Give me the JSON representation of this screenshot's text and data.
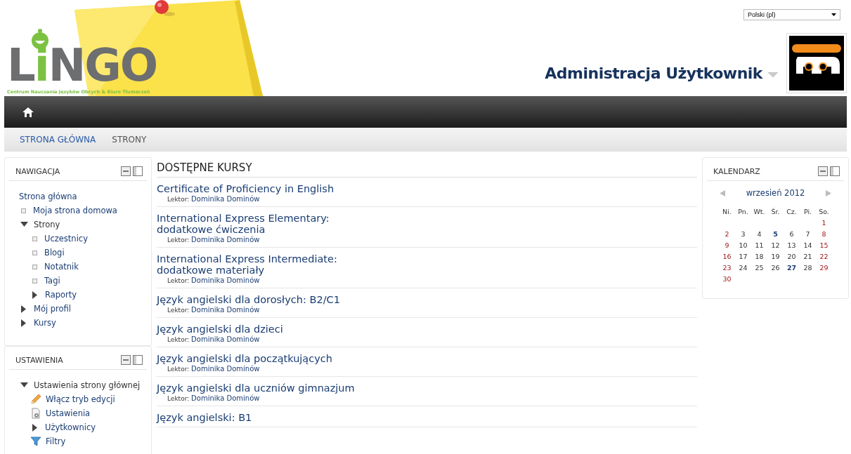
{
  "header": {
    "logo": {
      "name_start": "L",
      "name_face": "i",
      "name_end": "NGO",
      "tagline": "Centrum Nauczania Języków Obcych & Biuro Tłumaczeń"
    },
    "language": "Polski (pl)",
    "user_name": "Administracja Użytkownik"
  },
  "breadcrumb": [
    {
      "label": "STRONA GŁÓWNA",
      "link": true
    },
    {
      "label": "STRONY",
      "link": false
    }
  ],
  "navigation": {
    "title": "NAWIGACJA",
    "items": [
      {
        "label": "Strona główna",
        "kind": "home"
      },
      {
        "label": "Moja strona domowa",
        "kind": "leaf"
      },
      {
        "label": "Strony",
        "kind": "branch",
        "expanded": true,
        "children": [
          {
            "label": "Uczestnicy",
            "kind": "leaf"
          },
          {
            "label": "Blogi",
            "kind": "leaf"
          },
          {
            "label": "Notatnik",
            "kind": "leaf"
          },
          {
            "label": "Tagi",
            "kind": "leaf"
          },
          {
            "label": "Raporty",
            "kind": "branch",
            "expanded": false
          }
        ]
      },
      {
        "label": "Mój profil",
        "kind": "branch",
        "expanded": false
      },
      {
        "label": "Kursy",
        "kind": "branch",
        "expanded": false
      }
    ]
  },
  "settings": {
    "title": "USTAWIENIA",
    "items": [
      {
        "label": "Ustawienia strony głównej",
        "kind": "branch",
        "expanded": true,
        "children": [
          {
            "label": "Włącz tryb edycji",
            "kind": "edit"
          },
          {
            "label": "Ustawienia",
            "kind": "page"
          },
          {
            "label": "Użytkownicy",
            "kind": "branch",
            "expanded": false
          },
          {
            "label": "Filtry",
            "kind": "filter"
          }
        ]
      }
    ]
  },
  "courses": {
    "title": "DOSTĘPNE KURSY",
    "items": [
      {
        "title": "Certificate of Proficiency in English",
        "label": "Lektor:",
        "teacher": "Dominika Dominów"
      },
      {
        "title": "International Express Elementary:\ndodatkowe ćwiczenia",
        "label": "Lektor:",
        "teacher": "Dominika Dominów"
      },
      {
        "title": "International Express Intermediate:\ndodatkowe materiały",
        "label": "Lektor:",
        "teacher": "Dominika Dominów"
      },
      {
        "title": "Język angielski dla dorosłych: B2/C1",
        "label": "Lektor:",
        "teacher": "Dominika Dominów"
      },
      {
        "title": "Język angielski dla dzieci",
        "label": "Lektor:",
        "teacher": "Dominika Dominów"
      },
      {
        "title": "Język angielski dla początkujących",
        "label": "Lektor:",
        "teacher": "Dominika Dominów"
      },
      {
        "title": "Język angielski dla uczniów gimnazjum",
        "label": "Lektor:",
        "teacher": "Dominika Dominów"
      },
      {
        "title": "Język angielski: B1"
      }
    ]
  },
  "calendar": {
    "title": "KALENDARZ",
    "month": "wrzesień 2012",
    "weekdays": [
      "Ni.",
      "Pn.",
      "Wt.",
      "Śr.",
      "Cz.",
      "Pi.",
      "So."
    ],
    "weeks": [
      [
        {
          "kind": "empty"
        },
        {
          "kind": "empty"
        },
        {
          "kind": "empty"
        },
        {
          "kind": "empty"
        },
        {
          "kind": "empty"
        },
        {
          "kind": "empty"
        },
        {
          "day": "1",
          "kind": "weekend"
        }
      ],
      [
        {
          "day": "2",
          "kind": "weekend"
        },
        {
          "day": "3",
          "kind": "day"
        },
        {
          "day": "4",
          "kind": "day"
        },
        {
          "day": "5",
          "kind": "event"
        },
        {
          "day": "6",
          "kind": "day"
        },
        {
          "day": "7",
          "kind": "day"
        },
        {
          "day": "8",
          "kind": "weekend"
        }
      ],
      [
        {
          "day": "9",
          "kind": "weekend"
        },
        {
          "day": "10",
          "kind": "day"
        },
        {
          "day": "11",
          "kind": "day"
        },
        {
          "day": "12",
          "kind": "day"
        },
        {
          "day": "13",
          "kind": "day"
        },
        {
          "day": "14",
          "kind": "day"
        },
        {
          "day": "15",
          "kind": "weekend"
        }
      ],
      [
        {
          "day": "16",
          "kind": "weekend"
        },
        {
          "day": "17",
          "kind": "day"
        },
        {
          "day": "18",
          "kind": "day"
        },
        {
          "day": "19",
          "kind": "day"
        },
        {
          "day": "20",
          "kind": "day"
        },
        {
          "day": "21",
          "kind": "day"
        },
        {
          "day": "22",
          "kind": "weekend"
        }
      ],
      [
        {
          "day": "23",
          "kind": "weekend"
        },
        {
          "day": "24",
          "kind": "day"
        },
        {
          "day": "25",
          "kind": "day"
        },
        {
          "day": "26",
          "kind": "day"
        },
        {
          "day": "27",
          "kind": "event"
        },
        {
          "day": "28",
          "kind": "day"
        },
        {
          "day": "29",
          "kind": "weekend"
        }
      ],
      [
        {
          "day": "30",
          "kind": "weekend"
        },
        {
          "kind": "empty"
        },
        {
          "kind": "empty"
        },
        {
          "kind": "empty"
        },
        {
          "kind": "empty"
        },
        {
          "kind": "empty"
        },
        {
          "kind": "empty"
        }
      ]
    ]
  }
}
